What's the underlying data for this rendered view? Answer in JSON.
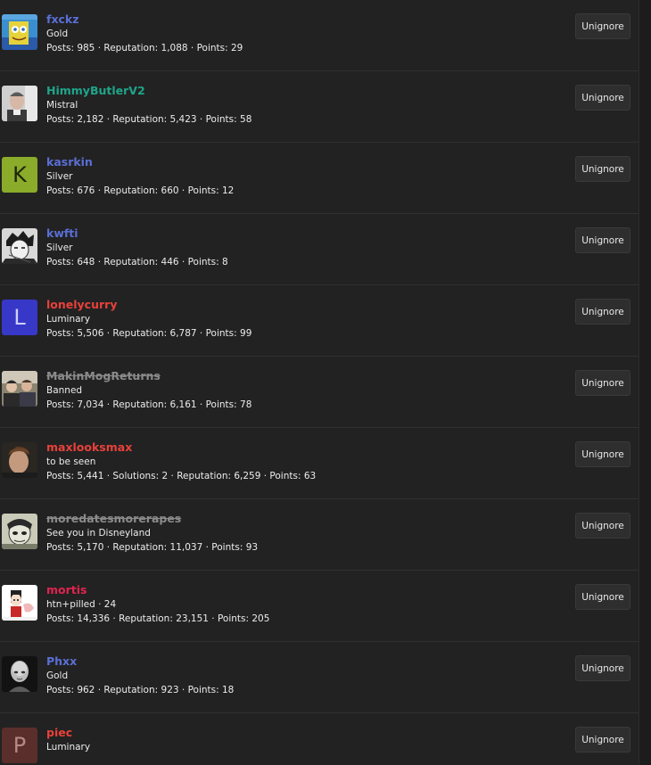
{
  "ignored_users": [
    {
      "username": "fxckz",
      "title": "Gold",
      "stats": "Posts: 985 · Reputation: 1,088 · Points: 29",
      "name_color": "#5a6fd6",
      "banned": false,
      "avatar": {
        "type": "image",
        "icon": "spongebob-avatar"
      },
      "button_label": "Unignore"
    },
    {
      "username": "HimmyButlerV2",
      "title": "Mistral",
      "stats": "Posts: 2,182 · Reputation: 5,423 · Points: 58",
      "name_color": "#1fa58a",
      "banned": false,
      "avatar": {
        "type": "image",
        "icon": "photo-avatar"
      },
      "button_label": "Unignore"
    },
    {
      "username": "kasrkin",
      "title": "Silver",
      "stats": "Posts: 676 · Reputation: 660 · Points: 12",
      "name_color": "#5a6fd6",
      "banned": false,
      "avatar": {
        "type": "letter",
        "letter": "K",
        "bg": "#8bab2a",
        "fg": "#1e2608"
      },
      "button_label": "Unignore"
    },
    {
      "username": "kwfti",
      "title": "Silver",
      "stats": "Posts: 648 · Reputation: 446 · Points: 8",
      "name_color": "#5a6fd6",
      "banned": false,
      "avatar": {
        "type": "image",
        "icon": "manga-avatar"
      },
      "button_label": "Unignore"
    },
    {
      "username": "lonelycurry",
      "title": "Luminary",
      "stats": "Posts: 5,506 · Reputation: 6,787 · Points: 99",
      "name_color": "#e8413a",
      "banned": false,
      "avatar": {
        "type": "letter",
        "letter": "L",
        "bg": "#3838c8",
        "fg": "#cfd0ff"
      },
      "button_label": "Unignore"
    },
    {
      "username": "MakinMogReturns",
      "title": "Banned",
      "stats": "Posts: 7,034 · Reputation: 6,161 · Points: 78",
      "name_color": "#8a8a8a",
      "banned": true,
      "avatar": {
        "type": "image",
        "icon": "group-photo-avatar"
      },
      "button_label": "Unignore"
    },
    {
      "username": "maxlooksmax",
      "title": "to be seen",
      "stats": "Posts: 5,441 · Solutions: 2 · Reputation: 6,259 · Points: 63",
      "name_color": "#e8413a",
      "banned": false,
      "avatar": {
        "type": "image",
        "icon": "selfie-avatar"
      },
      "button_label": "Unignore"
    },
    {
      "username": "moredatesmorerapes",
      "title": "See you in Disneyland",
      "stats": "Posts: 5,170 · Reputation: 11,037 · Points: 93",
      "name_color": "#8a8a8a",
      "banned": true,
      "avatar": {
        "type": "image",
        "icon": "sketch-avatar"
      },
      "button_label": "Unignore"
    },
    {
      "username": "mortis",
      "title": "htn+pilled · 24",
      "stats": "Posts: 14,336 · Reputation: 23,151 · Points: 205",
      "name_color": "#e0244f",
      "banned": false,
      "avatar": {
        "type": "image",
        "icon": "cartoon-avatar"
      },
      "button_label": "Unignore"
    },
    {
      "username": "Phxx",
      "title": "Gold",
      "stats": "Posts: 962 · Reputation: 923 · Points: 18",
      "name_color": "#5a6fd6",
      "banned": false,
      "avatar": {
        "type": "image",
        "icon": "bald-man-avatar"
      },
      "button_label": "Unignore"
    },
    {
      "username": "piec",
      "title": "Luminary",
      "stats": "",
      "name_color": "#e8413a",
      "banned": false,
      "avatar": {
        "type": "letter",
        "letter": "P",
        "bg": "#5a2e2a",
        "fg": "#b58a84"
      },
      "button_label": "Unignore"
    }
  ]
}
